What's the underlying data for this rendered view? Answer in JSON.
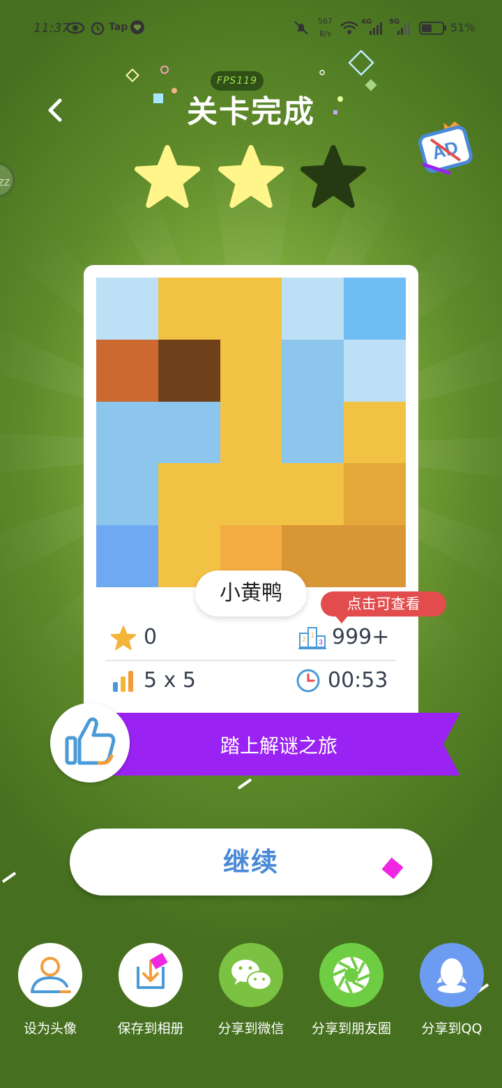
{
  "status_bar": {
    "time": "11:37",
    "app_badge": "Tap",
    "net_speed_top": "567",
    "net_speed_bottom": "B/s",
    "net_4g": "4G",
    "net_5g": "5G",
    "battery_percent": "51%"
  },
  "fps_badge": "FPS119",
  "title": "关卡完成",
  "stars": {
    "earned": 2,
    "total": 3
  },
  "side_badge": "ZZ",
  "puzzle": {
    "name": "小黄鸭",
    "grid_size_label": "5 x 5",
    "colors": [
      [
        "#bde0f7",
        "#f2c244",
        "#f2c244",
        "#bde0f7",
        "#6fbdf2"
      ],
      [
        "#cc6930",
        "#70401a",
        "#f2c244",
        "#8dc6ed",
        "#bde0f7"
      ],
      [
        "#8dc6ed",
        "#8dc6ed",
        "#f2c244",
        "#8dc6ed",
        "#f2c244"
      ],
      [
        "#8dc6ed",
        "#f2c244",
        "#f2c244",
        "#f2c244",
        "#e4a83a"
      ],
      [
        "#6fa9f2",
        "#f2c244",
        "#f3ad42",
        "#d99634",
        "#d99634"
      ]
    ]
  },
  "stats": {
    "stars_count": "0",
    "rank": "999+",
    "time": "00:53"
  },
  "tip": "点击可查看",
  "ribbon_text": "踏上解谜之旅",
  "continue_label": "继续",
  "share_actions": [
    {
      "label": "设为头像",
      "icon": "avatar-icon",
      "color": "#ffffff"
    },
    {
      "label": "保存到相册",
      "icon": "save-album-icon",
      "color": "#ffffff"
    },
    {
      "label": "分享到微信",
      "icon": "wechat-icon",
      "color": "#7cc242"
    },
    {
      "label": "分享到朋友圈",
      "icon": "moments-icon",
      "color": "#6fcd43"
    },
    {
      "label": "分享到QQ",
      "icon": "qq-icon",
      "color": "#6c9bf2"
    }
  ],
  "colors": {
    "ribbon": "#9a22f2",
    "accent_blue": "#4a89d8",
    "tip_red": "#e24c4c",
    "star_yellow": "#fff58a",
    "star_empty": "#253a12"
  }
}
